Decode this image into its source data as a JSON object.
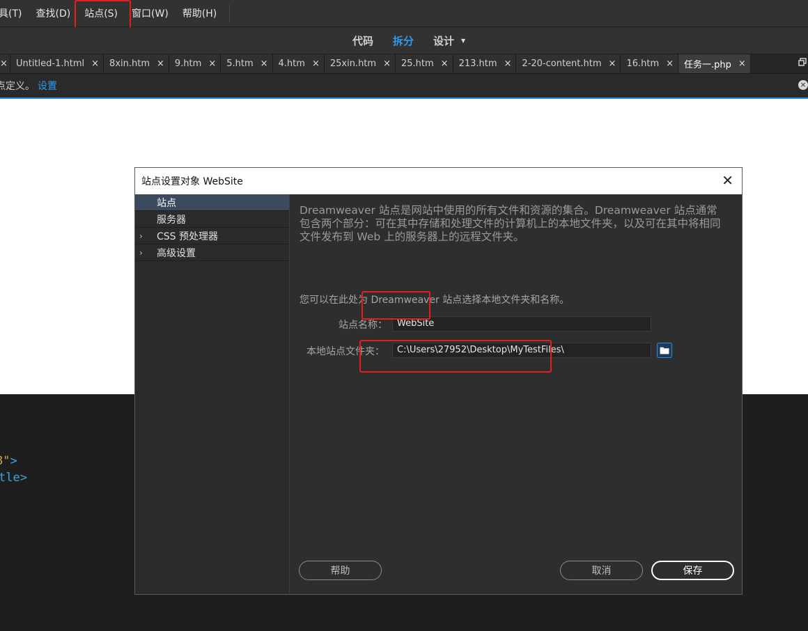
{
  "menubar": {
    "items": [
      "具(T)",
      "查找(D)",
      "站点(S)",
      "窗口(W)",
      "帮助(H)"
    ]
  },
  "viewbar": {
    "code": "代码",
    "split": "拆分",
    "design": "设计",
    "caret": "▾"
  },
  "tabs": [
    {
      "label": "Untitled-1.html"
    },
    {
      "label": "8xin.htm"
    },
    {
      "label": "9.htm"
    },
    {
      "label": "5.htm"
    },
    {
      "label": "4.htm"
    },
    {
      "label": "25xin.htm"
    },
    {
      "label": "25.htm"
    },
    {
      "label": "213.htm"
    },
    {
      "label": "2-20-content.htm"
    },
    {
      "label": "16.htm"
    },
    {
      "label": "任务一.php"
    }
  ],
  "tab_close": "×",
  "infobar": {
    "text": "点定义。",
    "link": "设置",
    "close": "×"
  },
  "code": {
    "line1_str": "8\"",
    "line1_tag": ">",
    "line2": "tle>"
  },
  "dialog": {
    "title": "站点设置对象 WebSite",
    "close": "✕",
    "sidebar": [
      {
        "label": "站点",
        "arrow": ""
      },
      {
        "label": "服务器",
        "arrow": ""
      },
      {
        "label": "CSS 预处理器",
        "arrow": "›"
      },
      {
        "label": "高级设置",
        "arrow": "›"
      }
    ],
    "description": "Dreamweaver 站点是网站中使用的所有文件和资源的集合。Dreamweaver 站点通常包含两个部分：可在其中存储和处理文件的计算机上的本地文件夹，以及可在其中将相同文件发布到 Web 上的服务器上的远程文件夹。",
    "choose_text": "您可以在此处为 Dreamweaver 站点选择本地文件夹和名称。",
    "site_name_label": "站点名称：",
    "site_name_value": "WebSite",
    "local_folder_label": "本地站点文件夹：",
    "local_folder_value": "C:\\Users\\27952\\Desktop\\MyTestFiles\\",
    "help": "帮助",
    "cancel": "取消",
    "save": "保存"
  },
  "colors": {
    "accent": "#2d9bf0",
    "highlight": "#e41f1f"
  }
}
